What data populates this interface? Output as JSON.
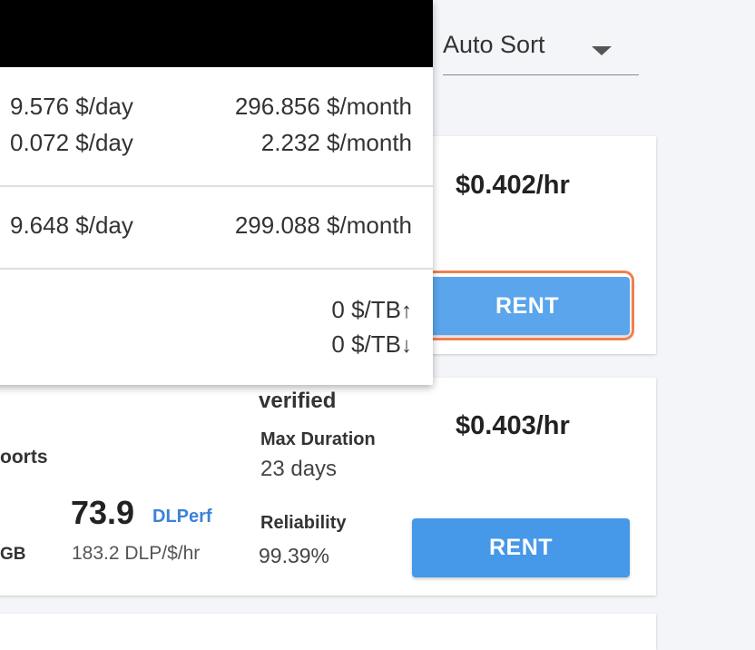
{
  "sort": {
    "label": "Auto Sort"
  },
  "card1": {
    "price": "$0.402/hr",
    "rent_label": "RENT"
  },
  "card2": {
    "verified": "verified",
    "max_duration_label": "Max Duration",
    "max_duration_value": "23 days",
    "reliability_label": "Reliability",
    "reliability_value": "99.39%",
    "ports_fragment": "oorts",
    "gb_fragment": "GB",
    "dlperf_value": "73.9",
    "dlperf_label": "DLPerf",
    "dlp_per_dollar": "183.2 DLP/$/hr",
    "price": "$0.403/hr",
    "rent_label": "RENT"
  },
  "popup": {
    "row1_day": "9.576 $/day",
    "row1_month": "296.856 $/month",
    "row2_day": "0.072 $/day",
    "row2_month": "2.232 $/month",
    "total_day": "9.648 $/day",
    "total_month": "299.088 $/month",
    "upload": "0 $/TB",
    "download": "0 $/TB"
  },
  "colors": {
    "accent": "#4698e8",
    "highlight": "#f27f4f",
    "dlperf_label": "#3b82d9"
  }
}
